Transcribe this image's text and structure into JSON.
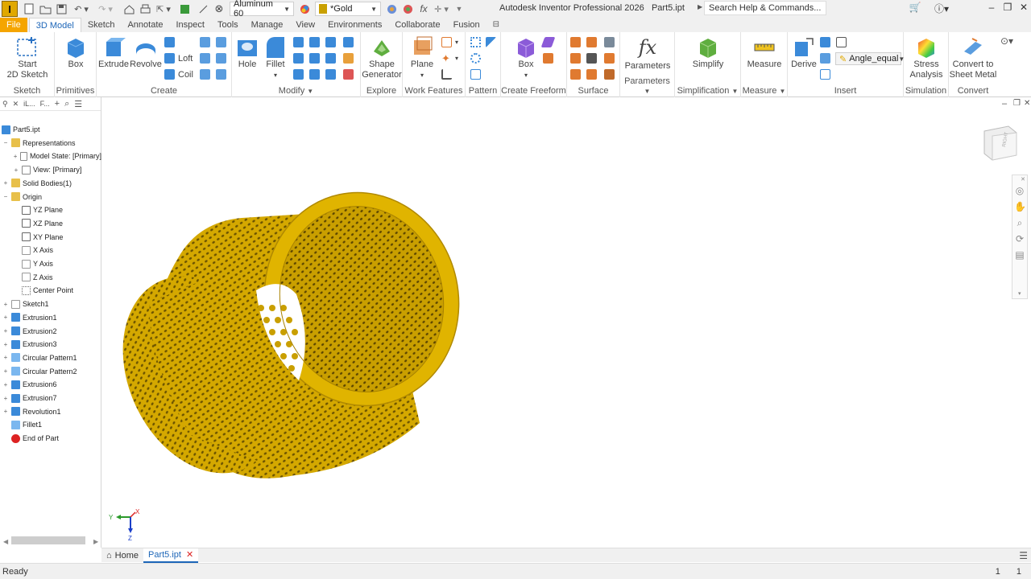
{
  "window": {
    "title": "Autodesk Inventor Professional 2026",
    "document": "Part5.ipt",
    "search_placeholder": "Search Help & Commands..."
  },
  "quick_access": {
    "material": "Aluminum 60",
    "appearance": "*Gold"
  },
  "ribbon_tabs": [
    "File",
    "3D Model",
    "Sketch",
    "Annotate",
    "Inspect",
    "Tools",
    "Manage",
    "View",
    "Environments",
    "Collaborate",
    "Fusion"
  ],
  "ribbon": {
    "sketch": {
      "start_label_1": "Start",
      "start_label_2": "2D Sketch",
      "group": "Sketch"
    },
    "primitives": {
      "box": "Box",
      "group": "Primitives"
    },
    "create": {
      "extrude": "Extrude",
      "revolve": "Revolve",
      "loft": "Loft",
      "coil": "Coil",
      "group": "Create"
    },
    "modify": {
      "hole": "Hole",
      "fillet": "Fillet",
      "group": "Modify"
    },
    "explore": {
      "shape_gen_1": "Shape",
      "shape_gen_2": "Generator",
      "group": "Explore"
    },
    "work_features": {
      "plane": "Plane",
      "group": "Work Features"
    },
    "pattern": {
      "group": "Pattern"
    },
    "freeform": {
      "box": "Box",
      "group": "Create Freeform"
    },
    "surface": {
      "group": "Surface"
    },
    "parameters": {
      "parameters": "Parameters",
      "group": "Parameters"
    },
    "simplification": {
      "simplify": "Simplify",
      "group": "Simplification"
    },
    "measure": {
      "measure": "Measure",
      "group": "Measure"
    },
    "insert": {
      "derive": "Derive",
      "angle_equal": "Angle_equal",
      "group": "Insert"
    },
    "simulation": {
      "stress_1": "Stress",
      "stress_2": "Analysis",
      "group": "Simulation"
    },
    "convert": {
      "convert_1": "Convert to",
      "convert_2": "Sheet Metal",
      "group": "Convert"
    }
  },
  "browser": {
    "tab1": "iL...",
    "tab2": "F...",
    "tree": [
      {
        "label": "Part5.ipt",
        "indent": 0
      },
      {
        "label": "Representations",
        "indent": 1
      },
      {
        "label": "Model State: [Primary]",
        "indent": 2
      },
      {
        "label": "View: [Primary]",
        "indent": 2
      },
      {
        "label": "Solid Bodies(1)",
        "indent": 1
      },
      {
        "label": "Origin",
        "indent": 1
      },
      {
        "label": "YZ Plane",
        "indent": 2
      },
      {
        "label": "XZ Plane",
        "indent": 2
      },
      {
        "label": "XY Plane",
        "indent": 2
      },
      {
        "label": "X Axis",
        "indent": 2
      },
      {
        "label": "Y Axis",
        "indent": 2
      },
      {
        "label": "Z Axis",
        "indent": 2
      },
      {
        "label": "Center Point",
        "indent": 2
      },
      {
        "label": "Sketch1",
        "indent": 1
      },
      {
        "label": "Extrusion1",
        "indent": 1
      },
      {
        "label": "Extrusion2",
        "indent": 1
      },
      {
        "label": "Extrusion3",
        "indent": 1
      },
      {
        "label": "Circular Pattern1",
        "indent": 1
      },
      {
        "label": "Circular Pattern2",
        "indent": 1
      },
      {
        "label": "Extrusion6",
        "indent": 1
      },
      {
        "label": "Extrusion7",
        "indent": 1
      },
      {
        "label": "Revolution1",
        "indent": 1
      },
      {
        "label": "Fillet1",
        "indent": 1
      },
      {
        "label": "End of Part",
        "indent": 1
      }
    ]
  },
  "viewcube": {
    "face": "RIGHT"
  },
  "axes": {
    "x": "X",
    "y": "Y",
    "z": "Z"
  },
  "doc_tabs": {
    "home": "Home",
    "part": "Part5.ipt"
  },
  "status": {
    "text": "Ready",
    "count1": "1",
    "count2": "1"
  },
  "colors": {
    "gold": "#d4a800",
    "accent": "#1d66b8",
    "file_tab": "#f5a500"
  }
}
